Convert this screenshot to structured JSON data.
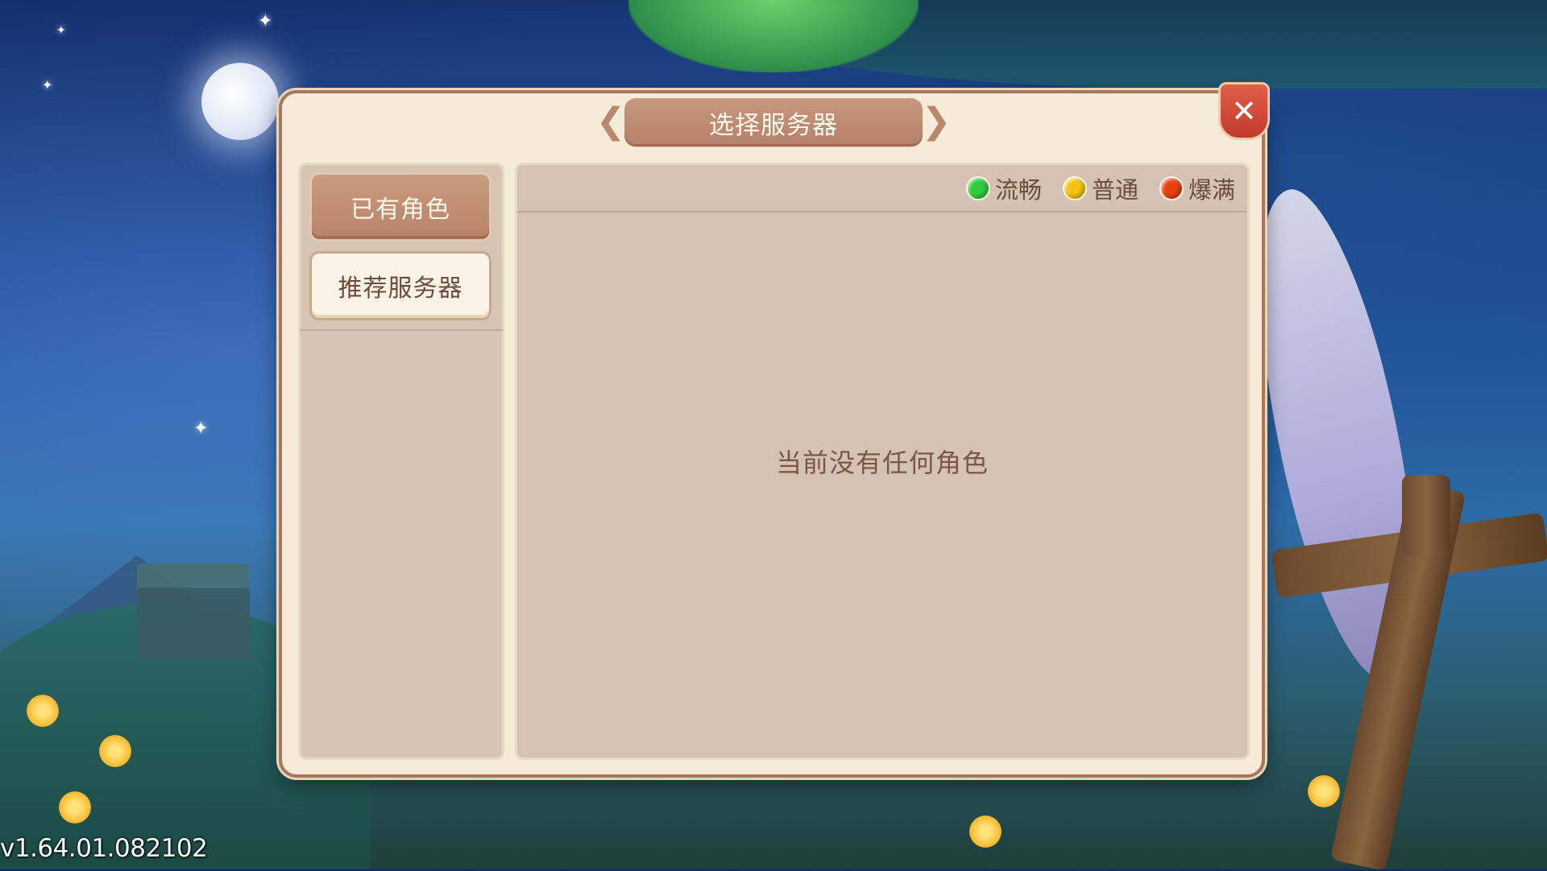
{
  "window": {
    "title": "选择服务器",
    "close_icon": "close-icon"
  },
  "tabs": [
    {
      "label": "已有角色",
      "active": true
    },
    {
      "label": "推荐服务器",
      "active": false
    }
  ],
  "legend": [
    {
      "label": "流畅",
      "color": "#2ecc40"
    },
    {
      "label": "普通",
      "color": "#f1c40f"
    },
    {
      "label": "爆满",
      "color": "#e8410f"
    }
  ],
  "empty_message": "当前没有任何角色",
  "version": "v1.64.01.082102",
  "colors": {
    "dialog_bg": "#f5ebd9",
    "panel_bg": "#d5c3b2",
    "accent": "#b88468",
    "close_button": "#c23a2c"
  }
}
